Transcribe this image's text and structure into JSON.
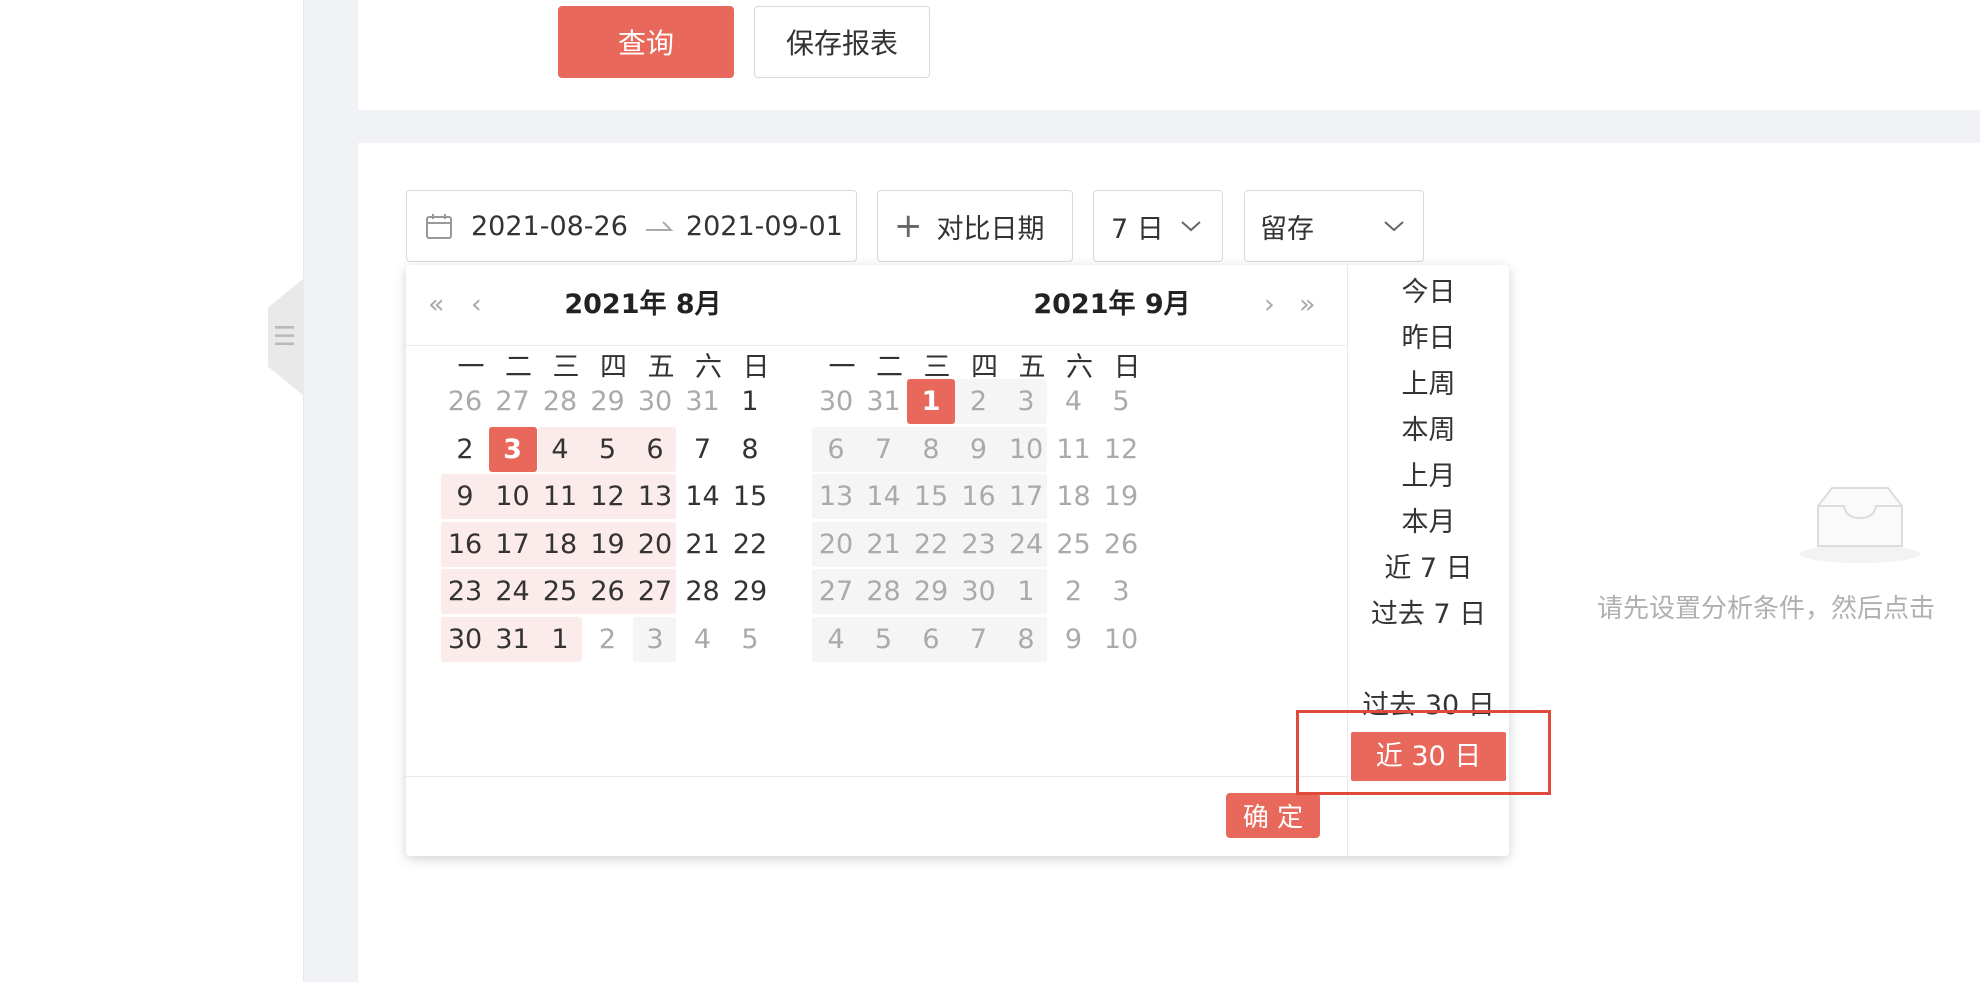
{
  "toolbar": {
    "query_label": "查询",
    "save_report_label": "保存报表"
  },
  "filters": {
    "date_start": "2021-08-26",
    "date_end": "2021-09-01",
    "compare_label": "对比日期",
    "period_value": "7 日",
    "metric_value": "留存"
  },
  "calendar": {
    "left_title": "2021年 8月",
    "right_title": "2021年 9月",
    "weekdays": [
      "一",
      "二",
      "三",
      "四",
      "五",
      "六",
      "日"
    ],
    "left_days": [
      "26",
      "27",
      "28",
      "29",
      "30",
      "31",
      "1",
      "2",
      "3",
      "4",
      "5",
      "6",
      "7",
      "8",
      "9",
      "10",
      "11",
      "12",
      "13",
      "14",
      "15",
      "16",
      "17",
      "18",
      "19",
      "20",
      "21",
      "22",
      "23",
      "24",
      "25",
      "26",
      "27",
      "28",
      "29",
      "30",
      "31",
      "1",
      "2",
      "3",
      "4",
      "5"
    ],
    "right_days": [
      "30",
      "31",
      "1",
      "2",
      "3",
      "4",
      "5",
      "6",
      "7",
      "8",
      "9",
      "10",
      "11",
      "12",
      "13",
      "14",
      "15",
      "16",
      "17",
      "18",
      "19",
      "20",
      "21",
      "22",
      "23",
      "24",
      "25",
      "26",
      "27",
      "28",
      "29",
      "30",
      "1",
      "2",
      "3",
      "4",
      "5",
      "6",
      "7",
      "8",
      "9",
      "10"
    ],
    "confirm_label": "确 定"
  },
  "presets": [
    "今日",
    "昨日",
    "上周",
    "本周",
    "上月",
    "本月",
    "近 7 日",
    "过去 7 日",
    "近 30 日",
    "过去 30 日"
  ],
  "active_preset": "近 30 日",
  "empty_state": {
    "text": "请先设置分析条件，然后点击"
  },
  "colors": {
    "accent": "#e8695c",
    "range_bg": "#fbebea",
    "disabled_bg": "#f5f5f5",
    "highlight": "#e04a3a"
  }
}
